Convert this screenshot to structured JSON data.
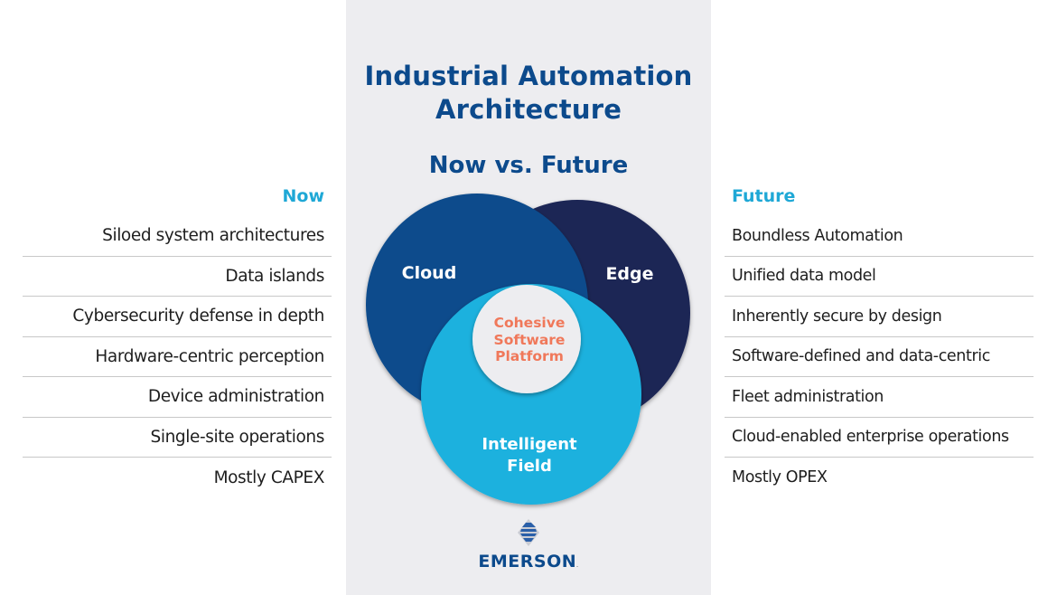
{
  "header": {
    "title_line1": "Industrial Automation",
    "title_line2": "Architecture",
    "subtitle": "Now vs. Future"
  },
  "now": {
    "heading": "Now",
    "items": [
      "Siloed system architectures",
      "Data islands",
      "Cybersecurity defense in depth",
      "Hardware-centric perception",
      "Device administration",
      "Single-site operations",
      "Mostly CAPEX"
    ]
  },
  "future": {
    "heading": "Future",
    "items": [
      "Boundless Automation",
      "Unified data model",
      "Inherently secure by design",
      "Software-defined and data-centric",
      "Fleet administration",
      "Cloud-enabled enterprise operations",
      "Mostly OPEX"
    ]
  },
  "venn": {
    "circles": [
      {
        "label": "Cloud",
        "color": "#0b4c8c"
      },
      {
        "label": "Edge",
        "color": "#1b2555"
      },
      {
        "label_line1": "Intelligent",
        "label_line2": "Field",
        "color": "#1fb1de"
      }
    ],
    "center": {
      "line1": "Cohesive",
      "line2": "Software",
      "line3": "Platform",
      "color": "#f0785a"
    }
  },
  "colors": {
    "title": "#0c4a8c",
    "heading_accent": "#1fa8d6",
    "panel_bg": "#ededf0",
    "divider": "#c8c8c8"
  },
  "logo": {
    "name": "EMERSON",
    "trademark": "."
  }
}
